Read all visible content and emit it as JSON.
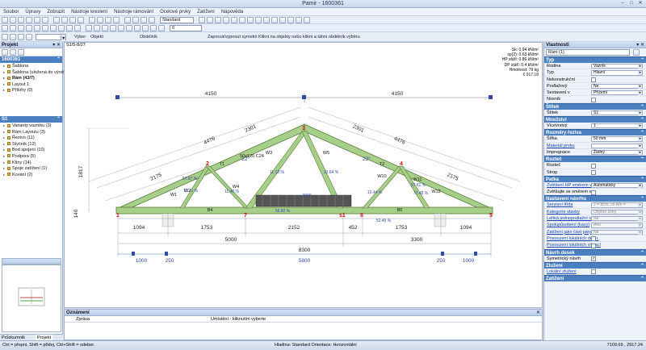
{
  "window": {
    "title": "Pamir - 1600361"
  },
  "menu": [
    "Soubor",
    "Úpravy",
    "Zobrazit",
    "Nástroje kreslení",
    "Nástroje rámování",
    "Ocelové prvky",
    "Zatížení",
    "Nápověda"
  ],
  "toolbar": {
    "style_combo": "Standard",
    "layer_combo": "0"
  },
  "selection_bar": {
    "select_label": "Vyber",
    "object_label": "Objekt",
    "rect_label": "Obdélník",
    "symmetry_label": "Zapnout/vypnout symetrii",
    "hint": "Klikni na objekty nebo klikni a táhni obdélník výběru"
  },
  "left_panel": {
    "title": "Projekt",
    "project_section": "1600361",
    "project_items": [
      "Šablona",
      "Šablona (uložená do výrobce)",
      "Rám (43/7)",
      "Layout 1",
      "Přílohy (0)"
    ],
    "s1_section": "S1",
    "s1_items": [
      "Varianty vazníku (3)",
      "Rám Layoutu (3)",
      "Řezivo (11)",
      "Styčník (12)",
      "Bod spojení (10)",
      "Podpora (5)",
      "Klíny (14)",
      "Spoje zatížení (1)",
      "Kování (2)"
    ],
    "tabs": [
      "Průzkumník",
      "Projekt"
    ]
  },
  "canvas": {
    "tag": "S1/5-8/27",
    "info_labels": [
      "Sk:",
      "sp(2):",
      "HP stáří:",
      "DP stáří:",
      "Hmotnost:"
    ],
    "info_values": [
      "0.94 kN/m²",
      "0.63 kN/m²",
      "0.86 kN/m²",
      "0.4 kN/m²",
      "79 kg"
    ],
    "price": "€ 917.18",
    "dims": {
      "left_half": "4150",
      "right_half": "4150",
      "total": "8300",
      "span_left": "5000",
      "span_right": "3300",
      "b1": "1094",
      "b2": "1753",
      "b3": "2152",
      "b4": "452",
      "b5": "1753",
      "b6": "1094",
      "ov_left": "1000",
      "ov_l2": "250",
      "ov_mid": "5800",
      "ov_r2": "250",
      "ov_right": "1000",
      "rafter_l1": "4476",
      "rafter_l2": "2301",
      "rafter_l3": "2175",
      "rafter_r1": "4476",
      "rafter_r2": "2301",
      "rafter_r3": "2175",
      "height": "1817",
      "side": "140",
      "pitch_l": "22°",
      "pitch_r": "22°"
    },
    "members": {
      "t1": "T1",
      "t2": "T2",
      "b4": "B4",
      "b5": "B5",
      "b1": "B1",
      "b2": "B2",
      "w1": "W1",
      "w2": "W2",
      "w3": "W3",
      "w4": "W4",
      "w5": "W5",
      "w10": "W10",
      "w11": "W11",
      "w12": "W12",
      "section": "50x120 C24",
      "p1": "57.97 %",
      "p2": "71.71 %",
      "p3": "11.46 %",
      "p4": "11.13 %",
      "p5": "12.64 %",
      "p6": "57.61 %",
      "p7": "72.48 %",
      "p8": "12.44 %",
      "p9": "56.82 %",
      "p10": "52.45 %",
      "p11": "3000"
    },
    "nodes": {
      "n1": "1",
      "n2": "2",
      "n3": "3",
      "n4": "4",
      "n5": "5",
      "n7": "7",
      "n8": "8",
      "s1": "s1"
    }
  },
  "output": {
    "title": "Oznámení",
    "col1": "Zpráva",
    "col2": "Umístění - kliknutím vyberte"
  },
  "right_panel": {
    "title": "Vlastnosti",
    "object_combo": "Rám (1)",
    "sections": {
      "typ": {
        "label": "Typ",
        "rows": [
          [
            "Rodina",
            "Vazník"
          ],
          [
            "Typ",
            "Hlavní"
          ],
          [
            "Nekonstrukční",
            ""
          ],
          [
            "Podlažový",
            "Ne"
          ],
          [
            "Sestavení v",
            "Přízemí"
          ],
          [
            "Nosník",
            ""
          ]
        ]
      },
      "stitek": {
        "label": "Štítek",
        "rows": [
          [
            "Štítek",
            "S1"
          ]
        ]
      },
      "mnozstvi": {
        "label": "Množství",
        "rows": [
          [
            "Vícevrstvý",
            "1"
          ]
        ]
      },
      "rozmery": {
        "label": "Rozměry řeziva",
        "rows": [
          [
            "Šířka",
            "50 mm"
          ],
          [
            "Materiál prvku",
            ""
          ],
          [
            "Impregnace",
            "Žádný"
          ]
        ]
      },
      "rozteč": {
        "label": "Rozteč",
        "rows": [
          [
            "Rozteč",
            ""
          ],
          [
            "Strop",
            ""
          ]
        ]
      },
      "patka": {
        "label": "Patka",
        "rows": [
          [
            "Zvětšení HP směrem ven",
            "Automaticky"
          ],
          [
            "Zvětšujte se směrem ven",
            ""
          ]
        ]
      },
      "nastaveni": {
        "label": "Nastavení návrhu",
        "rows": [
          [
            "Servisní třída",
            "2 = 85%, cíl Rm ="
          ],
          [
            "Kategorie stavby",
            "Obytné zóny"
          ],
          [
            "Lehká jednopodlažní stěha",
            "Ne"
          ],
          [
            "Spolupůsobení (kavy)",
            "Ano"
          ],
          [
            "Zatížení jako část páry",
            "Ne"
          ],
          [
            "Posouzení lokálních defor.",
            ""
          ],
          [
            "Posouzení lokálních vibrací",
            ""
          ]
        ]
      },
      "navrh": {
        "label": "Návrh desek",
        "rows": [
          [
            "Symetrický návrh",
            "✓"
          ]
        ]
      },
      "znuzeni": {
        "label": "Zlužení",
        "rows": [
          [
            "Lokální zlužení",
            ""
          ]
        ]
      },
      "zatizeni": {
        "label": "Zatížení",
        "rows": []
      }
    }
  },
  "status": {
    "left": "Ctrl = přepni, Shift = přidej, Ctrl+Shift = odeber.",
    "mid": "Hladina: Standard  Orientace: Horizontální",
    "right": "7109.69 , 2917.24"
  }
}
